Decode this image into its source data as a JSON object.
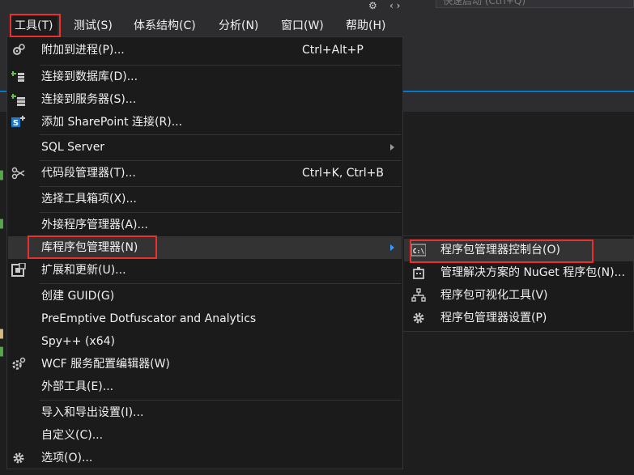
{
  "menubar": {
    "items": [
      {
        "label": "工具(T)"
      },
      {
        "label": "测试(S)"
      },
      {
        "label": "体系结构(C)"
      },
      {
        "label": "分析(N)"
      },
      {
        "label": "窗口(W)"
      },
      {
        "label": "帮助(H)"
      }
    ],
    "quick_launch_placeholder": "快速启动 (Ctrl+Q)"
  },
  "tools_menu": {
    "items": [
      {
        "label": "附加到进程(P)...",
        "shortcut": "Ctrl+Alt+P",
        "icon": "attach-process-icon"
      },
      {
        "label": "连接到数据库(D)...",
        "icon": "connect-database-icon"
      },
      {
        "label": "连接到服务器(S)...",
        "icon": "connect-server-icon"
      },
      {
        "label": "添加 SharePoint 连接(R)...",
        "icon": "sharepoint-icon"
      },
      {
        "label": "SQL Server",
        "has_submenu": true
      },
      {
        "label": "代码段管理器(T)...",
        "shortcut": "Ctrl+K, Ctrl+B",
        "icon": "snippet-icon"
      },
      {
        "label": "选择工具箱项(X)..."
      },
      {
        "label": "外接程序管理器(A)..."
      },
      {
        "label": "库程序包管理器(N)",
        "has_submenu": true
      },
      {
        "label": "扩展和更新(U)...",
        "icon": "extensions-icon"
      },
      {
        "label": "创建 GUID(G)"
      },
      {
        "label": "PreEmptive Dotfuscator and Analytics"
      },
      {
        "label": "Spy++ (x64)"
      },
      {
        "label": "WCF 服务配置编辑器(W)",
        "icon": "wcf-config-icon"
      },
      {
        "label": "外部工具(E)..."
      },
      {
        "label": "导入和导出设置(I)..."
      },
      {
        "label": "自定义(C)..."
      },
      {
        "label": "选项(O)...",
        "icon": "gear-icon"
      }
    ]
  },
  "package_manager_submenu": {
    "items": [
      {
        "label": "程序包管理器控制台(O)",
        "icon": "console-icon",
        "icon_text": "C:\\"
      },
      {
        "label": "管理解决方案的 NuGet 程序包(N)...",
        "icon": "nuget-icon"
      },
      {
        "label": "程序包可视化工具(V)",
        "icon": "visualizer-icon"
      },
      {
        "label": "程序包管理器设置(P)",
        "icon": "gear-icon"
      }
    ]
  },
  "colors": {
    "menu_bg": "#1b1b1c",
    "hover_bg": "#333334",
    "highlight_red": "#e8312f",
    "accent_blue": "#007acc"
  }
}
